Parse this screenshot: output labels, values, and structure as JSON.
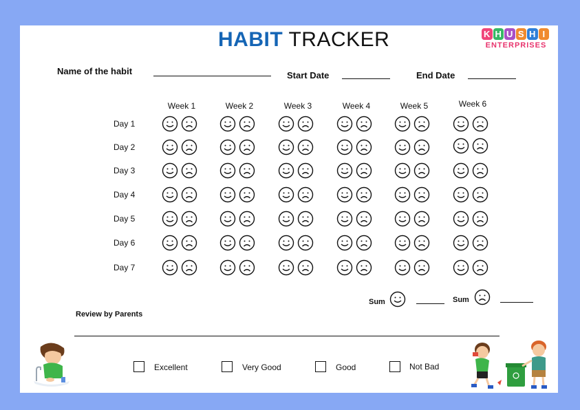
{
  "header": {
    "title_bold": "HABIT",
    "title_rest": "TRACKER",
    "logo": {
      "letters": [
        {
          "char": "K",
          "color": "#f0457a"
        },
        {
          "char": "H",
          "color": "#36b865"
        },
        {
          "char": "U",
          "color": "#a94fc6"
        },
        {
          "char": "S",
          "color": "#f08a2e"
        },
        {
          "char": "H",
          "color": "#2f7fd8"
        },
        {
          "char": "I",
          "color": "#f08a2e"
        }
      ],
      "subtitle": "ENTERPRISES"
    }
  },
  "fields": {
    "habit_name_label": "Name of the habit",
    "start_date_label": "Start Date",
    "end_date_label": "End Date"
  },
  "grid": {
    "weeks": [
      "Week 1",
      "Week 2",
      "Week 3",
      "Week 4",
      "Week 5",
      "Week 6"
    ],
    "days": [
      "Day 1",
      "Day 2",
      "Day 3",
      "Day 4",
      "Day 5",
      "Day 6",
      "Day 7"
    ],
    "icons": [
      "smiley-icon",
      "frowny-icon"
    ]
  },
  "sums": {
    "happy_label": "Sum",
    "sad_label": "Sum"
  },
  "review": {
    "label": "Review by Parents",
    "options": [
      "Excellent",
      "Very Good",
      "Good",
      "Not Bad"
    ]
  },
  "illustrations": {
    "left": "boy-washing-hands",
    "right": "kids-littering-and-recycling"
  },
  "colors": {
    "background": "#87a8f4",
    "title_accent": "#1565b5",
    "logo_subtitle": "#e8336d"
  }
}
